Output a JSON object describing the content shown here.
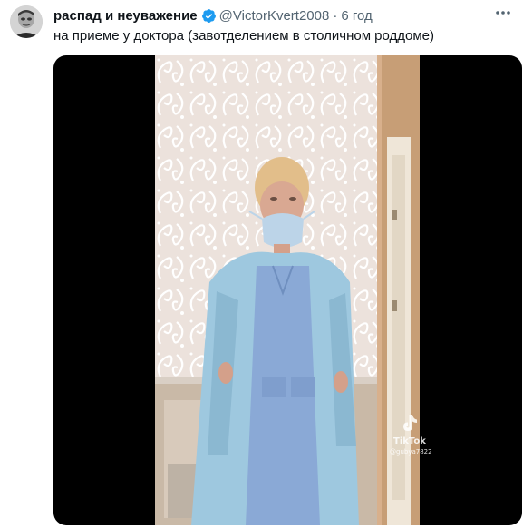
{
  "tweet": {
    "display_name": "распад и неуважение",
    "handle": "@VictorKvert2008",
    "separator": "·",
    "time": "6 год",
    "text": "на приеме у доктора (завотделением в столичном роддоме)",
    "verified": true
  },
  "media": {
    "type": "video",
    "watermark": {
      "brand": "TikTok",
      "username": "@gubya7822"
    }
  },
  "colors": {
    "verified_badge": "#1d9bf0",
    "secondary_text": "#536471",
    "primary_text": "#0f1419",
    "media_background": "#000000"
  },
  "icons": [
    "verified-badge-icon",
    "more-options-icon",
    "tiktok-logo-icon"
  ]
}
